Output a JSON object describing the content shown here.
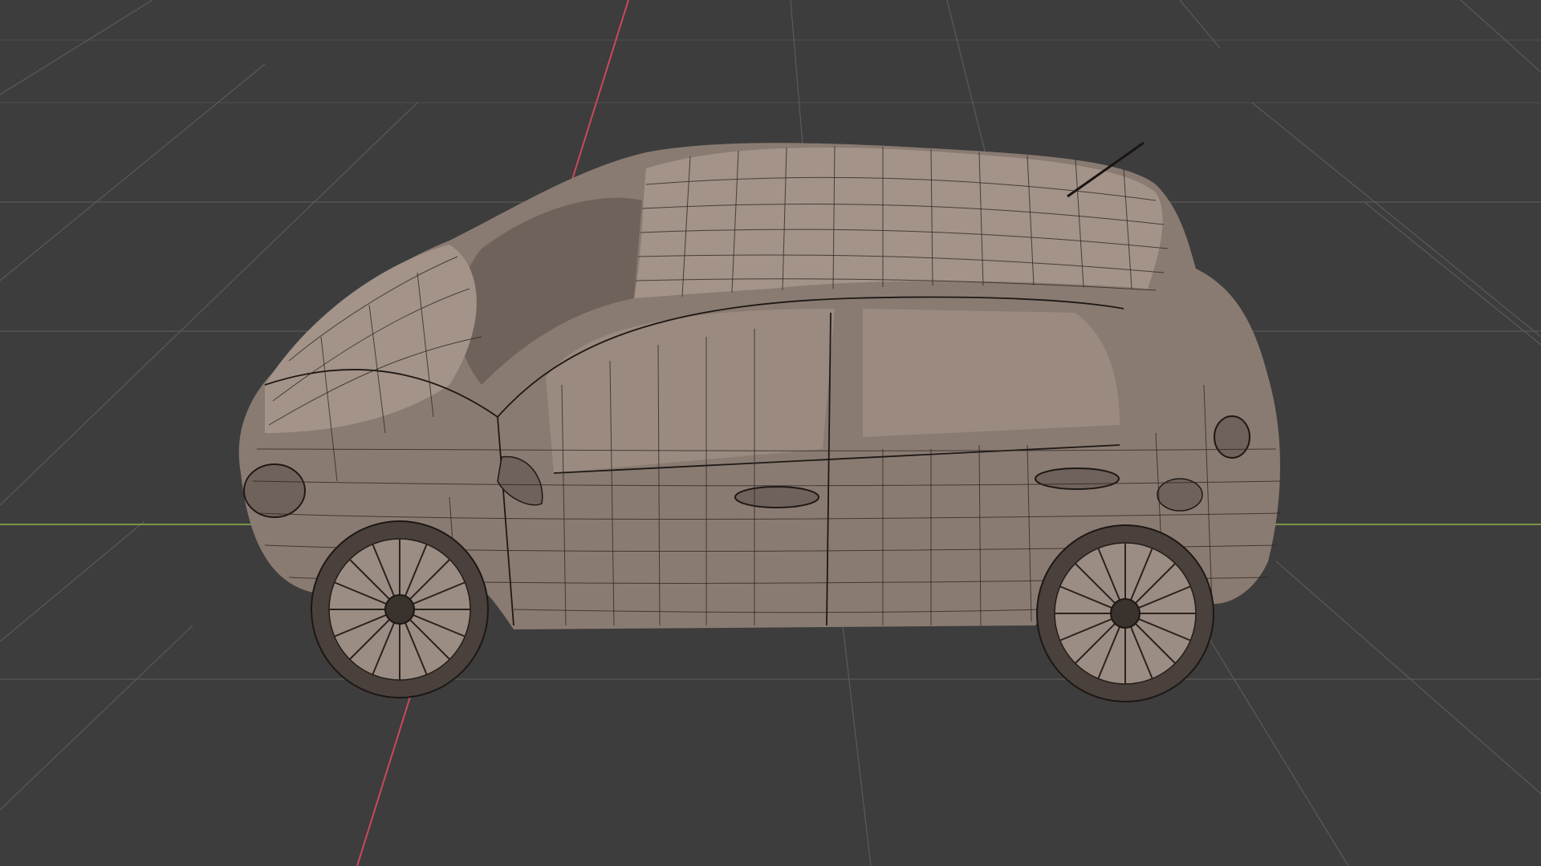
{
  "viewport": {
    "background": "#3d3d3d",
    "grid_color": "#5a5a5a",
    "x_axis_color": "#c94a5a",
    "y_axis_color": "#8db04a",
    "object": "car-wireframe-model",
    "shading": "solid-with-wireframe-overlay",
    "model_color": "#8a7b72"
  }
}
